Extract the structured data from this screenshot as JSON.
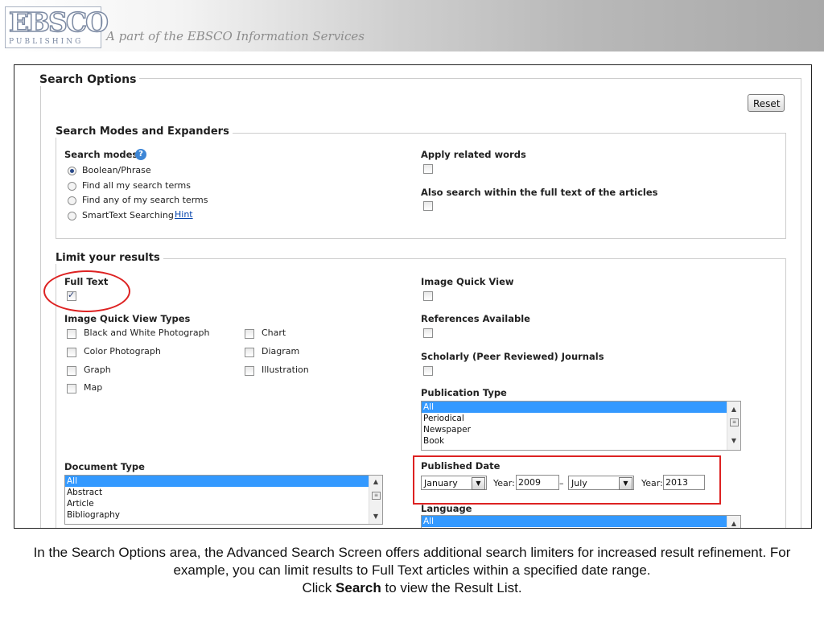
{
  "header": {
    "logo_text": "EBSCO",
    "logo_sub": "PUBLISHING",
    "tagline": "A part of the EBSCO Information Services"
  },
  "search_options": {
    "title": "Search Options",
    "reset_label": "Reset",
    "modes_section": {
      "title": "Search Modes and Expanders",
      "modes_label": "Search modes",
      "help_icon": "?",
      "modes": [
        {
          "label": "Boolean/Phrase",
          "selected": true
        },
        {
          "label": "Find all my search terms",
          "selected": false
        },
        {
          "label": "Find any of my search terms",
          "selected": false
        },
        {
          "label": "SmartText Searching",
          "selected": false
        }
      ],
      "hint_link": "Hint",
      "apply_related_label": "Apply related words",
      "full_text_search_label": "Also search within the full text of the articles"
    },
    "limit_section": {
      "title": "Limit your results",
      "full_text_label": "Full Text",
      "full_text_checked": true,
      "image_types_label": "Image Quick View Types",
      "image_types": [
        "Black and White Photograph",
        "Chart",
        "Color Photograph",
        "Diagram",
        "Graph",
        "Illustration",
        "Map"
      ],
      "image_quick_view_label": "Image Quick View",
      "references_label": "References Available",
      "scholarly_label": "Scholarly (Peer Reviewed) Journals",
      "publication_type_label": "Publication Type",
      "publication_types": [
        "All",
        "Periodical",
        "Newspaper",
        "Book"
      ],
      "document_type_label": "Document Type",
      "document_types": [
        "All",
        "Abstract",
        "Article",
        "Bibliography"
      ],
      "published_date_label": "Published Date",
      "date_from_month": "January",
      "date_from_year": "2009",
      "date_to_month": "July",
      "date_to_year": "2013",
      "year_label": "Year:",
      "range_dash": "–",
      "language_label": "Language",
      "languages": [
        "All"
      ]
    }
  },
  "caption": {
    "line1": "In the Search Options area, the Advanced Search Screen offers additional search limiters for increased result refinement. For example, you can limit results to Full Text articles within a specified date range.",
    "click_word": "Click",
    "search_word": "Search",
    "tail": "to view the Result List."
  },
  "colors": {
    "highlight": "#dd2222",
    "selection": "#3399ff",
    "link": "#0645ad"
  }
}
